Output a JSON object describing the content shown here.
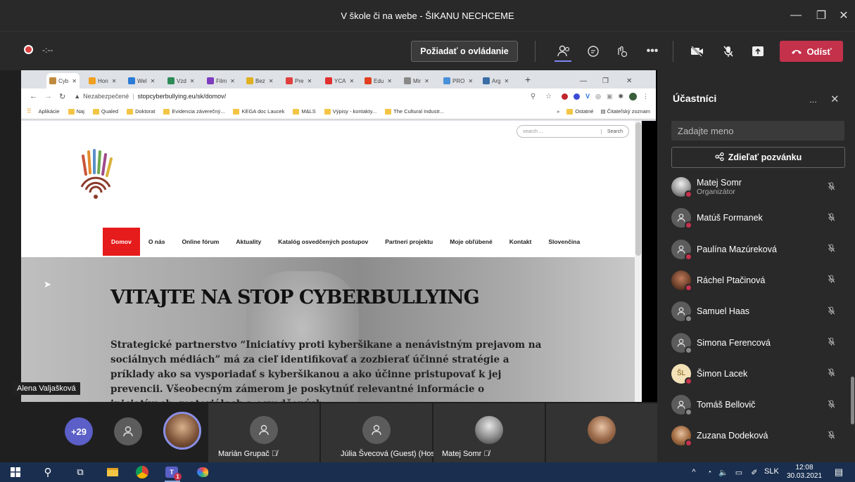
{
  "window": {
    "title": "V škole či na webe - ŠIKANU NECHCEME",
    "minimize": "—",
    "maximize": "❐",
    "close": "✕"
  },
  "meeting": {
    "timer": "-:--",
    "request_control": "Požiadať o ovládanie",
    "leave_label": "Odísť",
    "leave_color": "#c4314b"
  },
  "browser": {
    "tabs": [
      {
        "label": "Cyb",
        "color": "#c08a3e"
      },
      {
        "label": "Hon",
        "color": "#f0a020"
      },
      {
        "label": "Wel",
        "color": "#2b7bd6"
      },
      {
        "label": "Vzd",
        "color": "#2e8b57"
      },
      {
        "label": "Film",
        "color": "#7d3cc0"
      },
      {
        "label": "Bez",
        "color": "#e0b020"
      },
      {
        "label": "Pre",
        "color": "#e04040"
      },
      {
        "label": "YCA",
        "color": "#e03030"
      },
      {
        "label": "Edu",
        "color": "#e04020"
      },
      {
        "label": "Mir",
        "color": "#888888"
      },
      {
        "label": "PRO",
        "color": "#4a90d9"
      },
      {
        "label": "Arg",
        "color": "#3a6ea5"
      }
    ],
    "new_tab": "+",
    "address_warning": "Nezabezpečené",
    "address_url": "stopcyberbullying.eu/sk/domov/",
    "bookmarks": [
      "Aplikácie",
      "Naj",
      "Qualed",
      "Doktorat",
      "Evidencia záverečný...",
      "KEGA doc Laucek",
      "M&LS",
      "Výpisy - kontakty...",
      "The Cultural Industr..."
    ],
    "bookmarks_more": "»",
    "bookmarks_other": "Ostatné",
    "reading_list": "Čitateľský zoznam"
  },
  "site": {
    "search_placeholder": "search ...",
    "search_button": "Search",
    "nav": [
      "Domov",
      "O nás",
      "Online fórum",
      "Aktuality",
      "Katalóg osvedčených postupov",
      "Partneri projektu",
      "Moje obľúbené",
      "Kontakt",
      "Slovenčina"
    ],
    "nav_active_color": "#e61b1b",
    "heading": "VITAJTE NA STOP CYBERBULLYING",
    "paragraph": "Strategické partnerstvo “Iniciatívy proti kyberšikane a nenávistným prejavom na sociálnych médiách” má za cieľ identifikovať a zozbierať účinné stratégie a príklady ako sa vysporiadať s kyberšikanou a ako účinne pristupovať k jej prevencii. Všeobecným zámerom je poskytnúť relevantné informácie o iniciatívach, materiáloch a osvedčených"
  },
  "presenter_label": "Alena Valjašková",
  "stage": {
    "more_count": "+29",
    "tiles": [
      {
        "name": "Marián Grupač"
      },
      {
        "name": "Júlia Švecová (Guest) (Hosť)"
      },
      {
        "name": "Matej Somr"
      },
      {
        "name": ""
      }
    ]
  },
  "participants": {
    "title": "Účastníci",
    "more": "...",
    "close": "✕",
    "name_placeholder": "Zadajte meno",
    "invite_label": "Zdieľať pozvánku",
    "list": [
      {
        "name": "Matej Somr",
        "role": "Organizátor",
        "avatar": "photo"
      },
      {
        "name": "Matúš Formanek",
        "role": "",
        "avatar": "generic"
      },
      {
        "name": "Paulína Mazúreková",
        "role": "",
        "avatar": "generic"
      },
      {
        "name": "Ráchel Ptačinová",
        "role": "",
        "avatar": "photo"
      },
      {
        "name": "Samuel Haas",
        "role": "",
        "avatar": "generic"
      },
      {
        "name": "Simona Ferencová",
        "role": "",
        "avatar": "generic"
      },
      {
        "name": "Šimon Lacek",
        "role": "",
        "avatar": "initials",
        "initials": "ŠL"
      },
      {
        "name": "Tomáš Bellovič",
        "role": "",
        "avatar": "generic"
      },
      {
        "name": "Zuzana Dodeková",
        "role": "",
        "avatar": "photo"
      }
    ]
  },
  "taskbar": {
    "language": "SLK",
    "time": "12:08",
    "date": "30.03.2021",
    "teams_badge": "1"
  }
}
